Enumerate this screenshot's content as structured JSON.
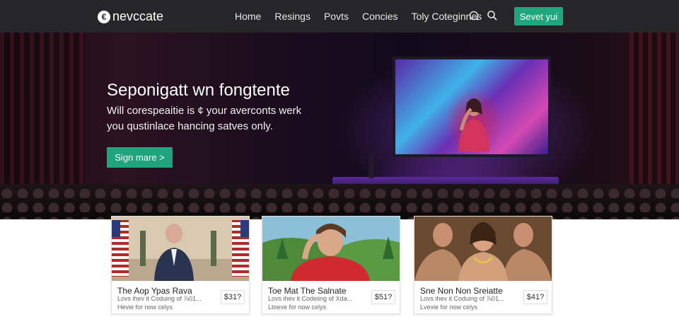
{
  "brand": {
    "name": "nevccate",
    "mark": "€"
  },
  "nav": {
    "links": [
      "Home",
      "Resings",
      "Povts",
      "Concies",
      "Toly Coteginnes"
    ],
    "icons": [
      "chat-icon",
      "search-icon"
    ],
    "cta_label": "Sevet yui"
  },
  "hero": {
    "title": "Seponigatt wn fongtente",
    "subtitle": "Will corespeaitie is ¢ your averconts werk you qustinlace hancing satves only.",
    "cta_label": "Sign mare >"
  },
  "cards": [
    {
      "title": "The Aop Ypas Rava",
      "meta1": "Lovs ihev it Coduing of ⅞01...",
      "meta2": "Hevie for now celys",
      "price": "$31?"
    },
    {
      "title": "Toe Mat The Salnate",
      "meta1": "Lovs ihev it Codeiing of Xda...",
      "meta2": "Ltoeve for now celys",
      "price": "$51?"
    },
    {
      "title": "Sne Non Non Sreiatte",
      "meta1": "Lovs ihev it Coduing of ⅞01...",
      "meta2": "Lvevie for now celys",
      "price": "$41?"
    }
  ],
  "colors": {
    "accent": "#1fa67a",
    "nav_bg": "#262628"
  }
}
